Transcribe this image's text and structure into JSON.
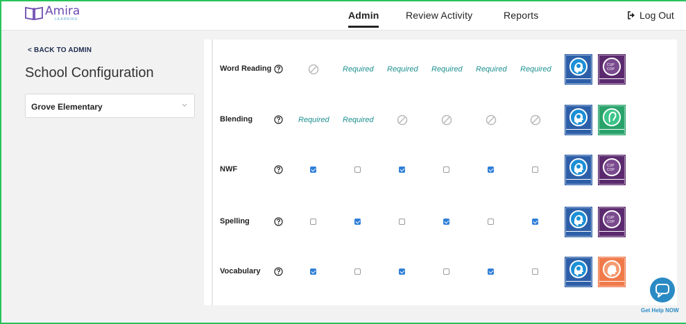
{
  "header": {
    "logo_name": "Amira",
    "logo_sub": "LEARNING",
    "nav": [
      {
        "label": "Admin",
        "active": true
      },
      {
        "label": "Review Activity",
        "active": false
      },
      {
        "label": "Reports",
        "active": false
      }
    ],
    "logout_label": "Log Out"
  },
  "sidebar": {
    "back_label": "< BACK TO ADMIN",
    "title": "School Configuration",
    "school_select": {
      "value": "Grove Elementary"
    }
  },
  "rows": [
    {
      "label": "Word Reading",
      "cells": [
        "na",
        "Required",
        "Required",
        "Required",
        "Required",
        "Required"
      ],
      "badges": [
        "Dyslexia Screener",
        "Decoding"
      ]
    },
    {
      "label": "Blending",
      "cells": [
        "Required",
        "Required",
        "na",
        "na",
        "na",
        "na"
      ],
      "badges": [
        "Dyslexia Screener",
        "Phonemic Awareness"
      ]
    },
    {
      "label": "NWF",
      "cells": [
        true,
        false,
        true,
        false,
        true,
        false
      ],
      "badges": [
        "Dyslexia Screener",
        "Decoding"
      ]
    },
    {
      "label": "Spelling",
      "cells": [
        false,
        true,
        false,
        true,
        false,
        true
      ],
      "badges": [
        "Dyslexia Screener",
        "Decoding"
      ]
    },
    {
      "label": "Vocabulary",
      "cells": [
        true,
        false,
        true,
        false,
        true,
        false
      ],
      "badges": [
        "Dyslexia Screener",
        "Comprehension"
      ]
    }
  ],
  "badge_glyph_text": {
    "decoding": "CUP COP"
  },
  "help_widget": {
    "label": "Get Help NOW"
  },
  "colors": {
    "accent_teal": "#1f9090",
    "checkbox_blue": "#2f7fd8",
    "brand_purple": "#6c4ab1",
    "screener_blue": "#2d5fa8",
    "decoding_purple": "#5b2a6e",
    "phonemic_green": "#2aa36b",
    "comprehension_orange": "#f07a4a",
    "frame_green": "#27c25a"
  },
  "icons": [
    "book-logo-icon",
    "logout-icon",
    "chevron-down-icon",
    "help-circle-icon",
    "not-applicable-icon",
    "head-brain-icon",
    "chat-bubble-icon"
  ]
}
